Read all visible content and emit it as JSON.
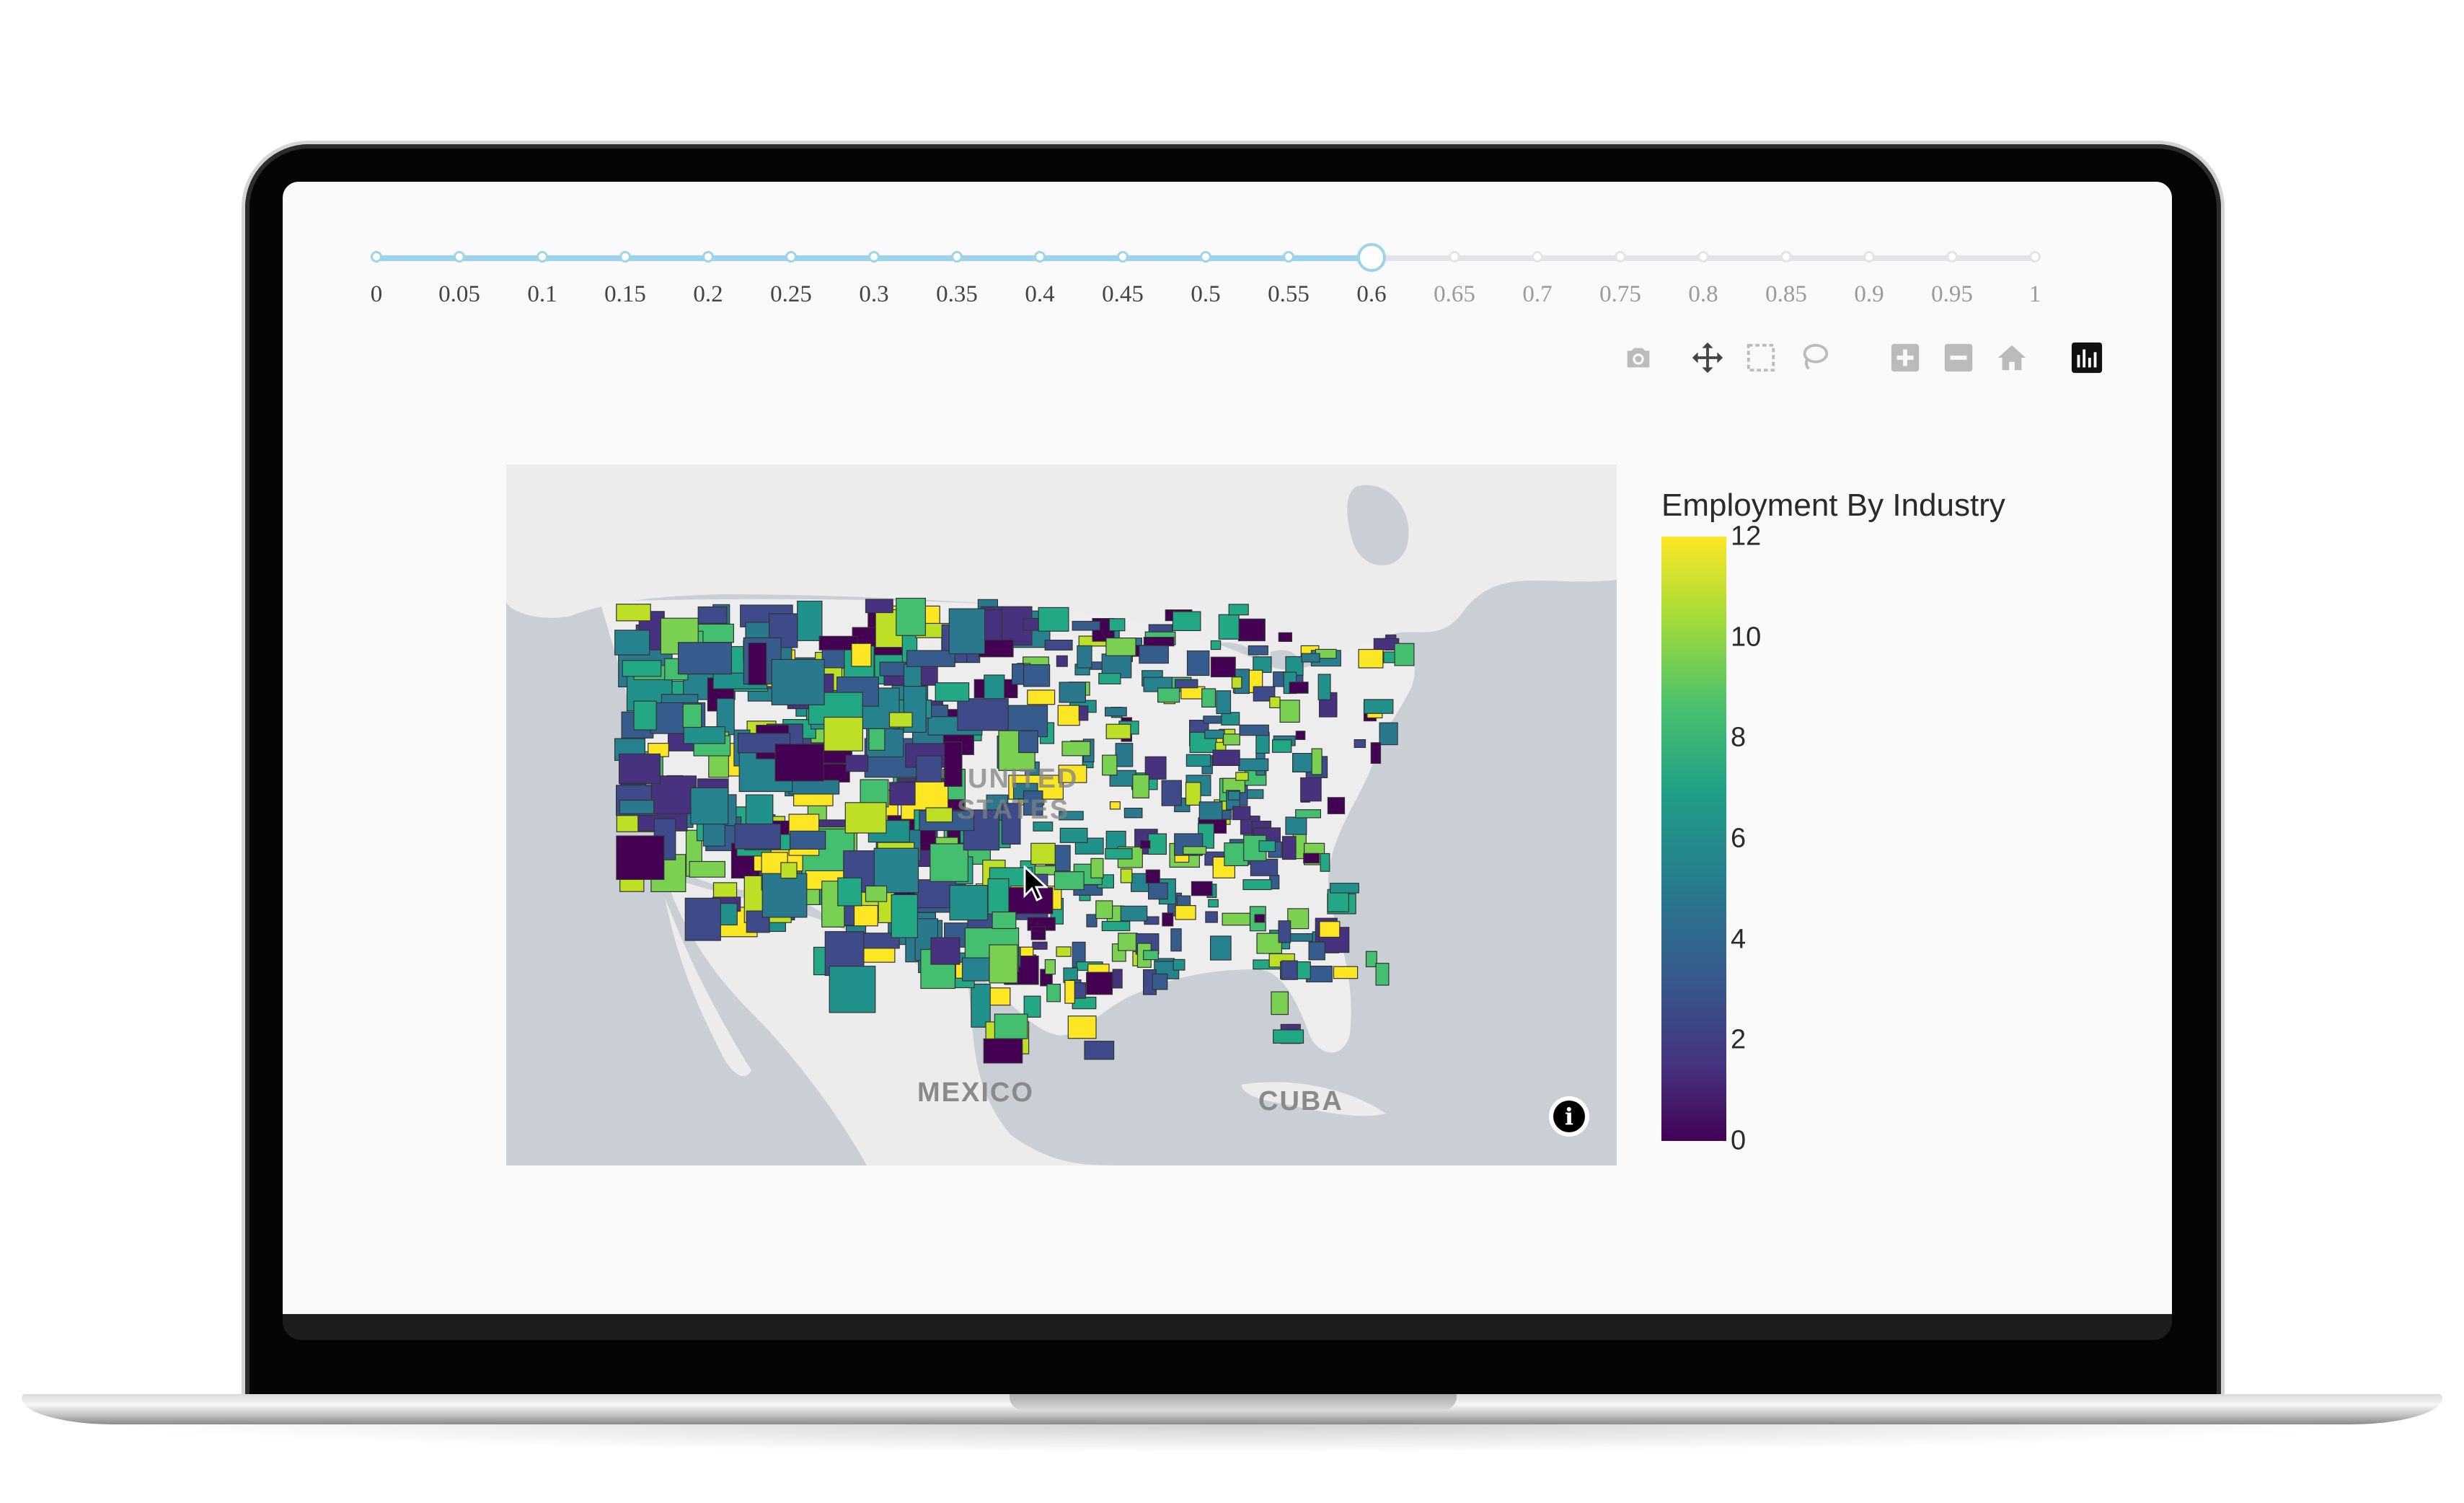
{
  "slider": {
    "steps": [
      "0",
      "0.05",
      "0.1",
      "0.15",
      "0.2",
      "0.25",
      "0.3",
      "0.35",
      "0.4",
      "0.45",
      "0.5",
      "0.55",
      "0.6",
      "0.65",
      "0.7",
      "0.75",
      "0.8",
      "0.85",
      "0.9",
      "0.95",
      "1"
    ],
    "active_index": 12,
    "active_value": "0.6",
    "active_color": "#9dd4ec",
    "inactive_color": "#e2e4e7"
  },
  "modebar": {
    "buttons": [
      "camera-icon",
      "pan-icon",
      "box-select-icon",
      "lasso-icon",
      "zoom-in-icon",
      "zoom-out-icon",
      "home-icon",
      "plotly-logo-icon"
    ]
  },
  "map": {
    "labels": {
      "mexico": "MEXICO",
      "cuba": "CUBA",
      "united_states_line1": "UNITED",
      "united_states_line2": "STATES"
    },
    "info_glyph": "i"
  },
  "chart_data": {
    "type": "heatmap",
    "title": "Employment By Industry",
    "colorscale": "viridis",
    "colorbar_range": [
      0,
      12
    ],
    "colorbar_ticks": [
      "12",
      "10",
      "8",
      "6",
      "4",
      "2",
      "0"
    ],
    "colors": {
      "low": "#440154",
      "mid": "#21918c",
      "high": "#fde725"
    }
  }
}
